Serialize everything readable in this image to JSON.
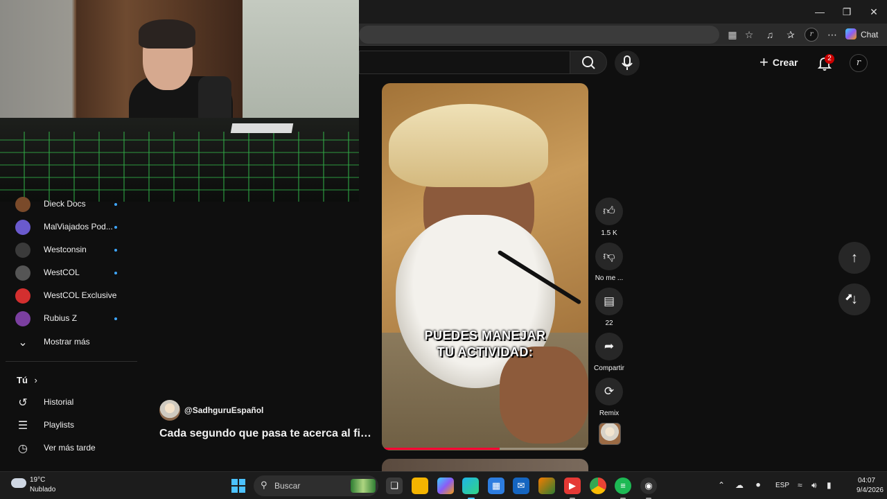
{
  "browser": {
    "chat_label": "Chat",
    "profile_initial": "r",
    "window_controls": [
      "minimize",
      "restore",
      "close"
    ]
  },
  "masthead": {
    "create_label": "Crear",
    "notifications_count": "2",
    "avatar_initial": "r"
  },
  "sidebar": {
    "subscriptions": [
      {
        "label": "Dieck Docs",
        "new": true,
        "color": "#7a4a2a"
      },
      {
        "label": "MalViajados Pod...",
        "new": true,
        "color": "#6a5acd"
      },
      {
        "label": "Westconsin",
        "new": true,
        "color": "#3a3a3a"
      },
      {
        "label": "WestCOL",
        "new": true,
        "color": "#555555"
      },
      {
        "label": "WestCOL Exclusive",
        "new": false,
        "color": "#d32f2f"
      },
      {
        "label": "Rubius Z",
        "new": true,
        "color": "#7b3fa0"
      }
    ],
    "show_more_label": "Mostrar más",
    "you_section": "Tú",
    "you_items": [
      {
        "label": "Historial",
        "icon": "history-icon"
      },
      {
        "label": "Playlists",
        "icon": "playlists-icon"
      },
      {
        "label": "Ver más tarde",
        "icon": "watch-later-icon"
      }
    ]
  },
  "short": {
    "channel": "@SadhguruEspañol",
    "title": "Cada segundo que pasa te acerca al fin...",
    "caption_line1": "PUEDES MANEJAR",
    "caption_line2": "TU ACTIVIDAD:",
    "progress": 0.57,
    "progress_color": "#ff0033"
  },
  "actions": {
    "like_count": "1.5 K",
    "dislike_label": "No me ...",
    "comments_count": "22",
    "share_label": "Compartir",
    "remix_label": "Remix"
  },
  "taskbar": {
    "temperature": "19°C",
    "weather": "Nublado",
    "search_label": "Buscar",
    "language": "ESP",
    "time": "04:07",
    "date": "9/4/2026"
  }
}
